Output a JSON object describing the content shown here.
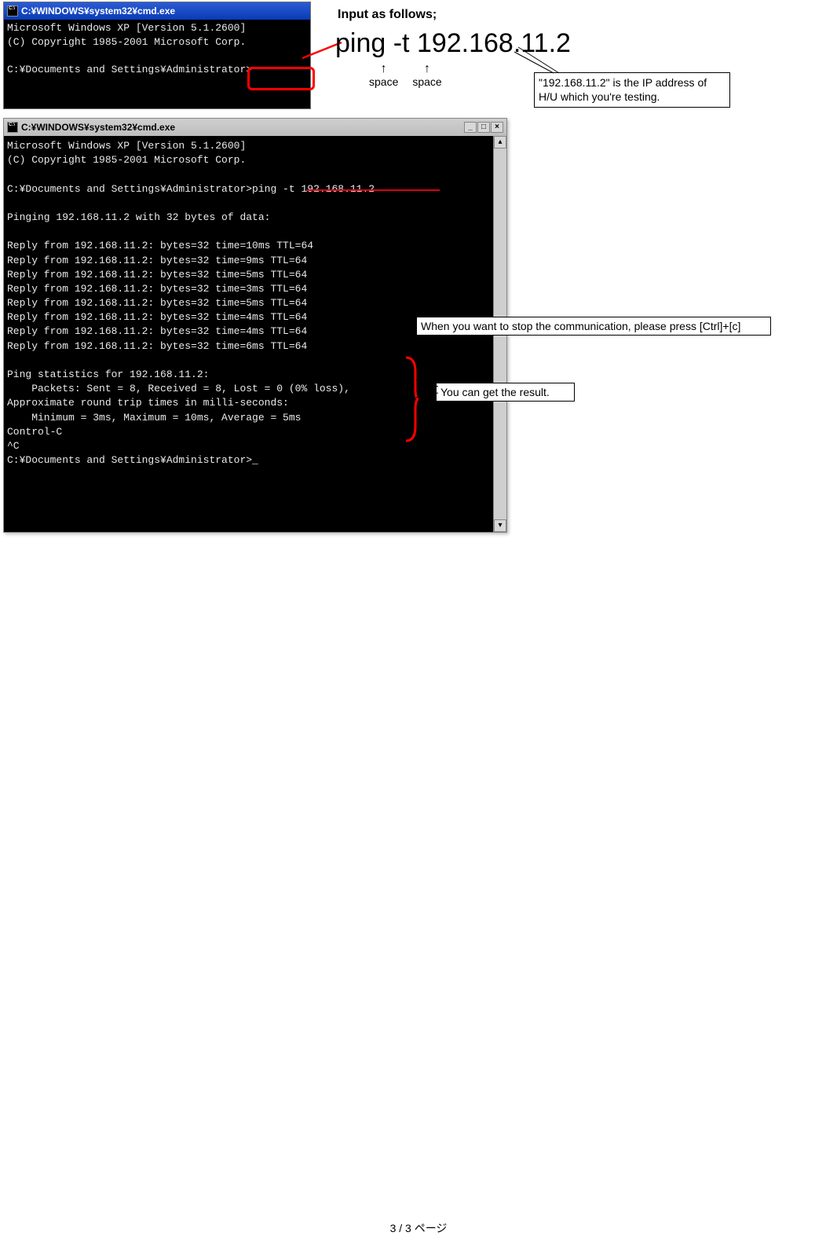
{
  "cmd_small": {
    "title": "C:¥WINDOWS¥system32¥cmd.exe",
    "line1": "Microsoft Windows XP [Version 5.1.2600]",
    "line2": "(C) Copyright 1985-2001 Microsoft Corp.",
    "prompt": "C:¥Documents and Settings¥Administrator>"
  },
  "instruction": {
    "heading": "Input as follows;",
    "command": "ping  -t  192.168.11.2",
    "space": "space",
    "ip_note": "\"192.168.11.2\" is the IP address of H/U which you're testing."
  },
  "cmd_large": {
    "title": "C:¥WINDOWS¥system32¥cmd.exe",
    "line1": "Microsoft Windows XP [Version 5.1.2600]",
    "line2": "(C) Copyright 1985-2001 Microsoft Corp.",
    "prompt_cmd": "C:¥Documents and Settings¥Administrator>ping -t 192.168.11.2",
    "pinging": "Pinging 192.168.11.2 with 32 bytes of data:",
    "reply1": "Reply from 192.168.11.2: bytes=32 time=10ms TTL=64",
    "reply2": "Reply from 192.168.11.2: bytes=32 time=9ms TTL=64",
    "reply3": "Reply from 192.168.11.2: bytes=32 time=5ms TTL=64",
    "reply4": "Reply from 192.168.11.2: bytes=32 time=3ms TTL=64",
    "reply5": "Reply from 192.168.11.2: bytes=32 time=5ms TTL=64",
    "reply6": "Reply from 192.168.11.2: bytes=32 time=4ms TTL=64",
    "reply7": "Reply from 192.168.11.2: bytes=32 time=4ms TTL=64",
    "reply8": "Reply from 192.168.11.2: bytes=32 time=6ms TTL=64",
    "stats1": "Ping statistics for 192.168.11.2:",
    "stats2": "    Packets: Sent = 8, Received = 8, Lost = 0 (0% loss),",
    "stats3": "Approximate round trip times in milli-seconds:",
    "stats4": "    Minimum = 3ms, Maximum = 10ms, Average = 5ms",
    "ctrlc1": "Control-C",
    "ctrlc2": "^C",
    "prompt_end": "C:¥Documents and Settings¥Administrator>_"
  },
  "callouts": {
    "stop": "When you want to stop the communication, please press [Ctrl]+[c]",
    "result": "You can get the result."
  },
  "footer": "3 / 3 ページ"
}
